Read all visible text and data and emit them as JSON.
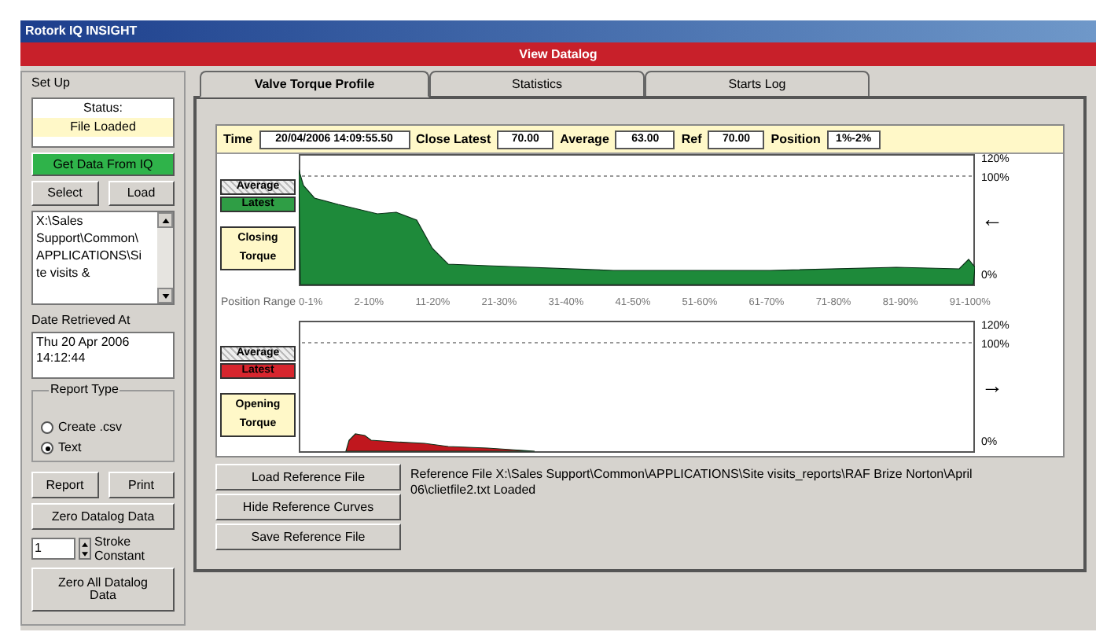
{
  "window": {
    "title": "Rotork IQ INSIGHT"
  },
  "header": {
    "title": "View Datalog"
  },
  "setup": {
    "label": "Set Up",
    "status_label": "Status:",
    "status_value": "File Loaded",
    "get_data_button": "Get Data From IQ",
    "select_button": "Select",
    "load_button": "Load",
    "file_list": [
      "X:\\Sales",
      "Support\\Common\\",
      "APPLICATIONS\\Si",
      "te visits &"
    ],
    "date_label": "Date Retrieved At",
    "date_value": [
      "Thu 20 Apr 2006",
      "14:12:44"
    ],
    "report_type": {
      "label": "Report Type",
      "options": [
        {
          "label": "Create .csv",
          "selected": false
        },
        {
          "label": "Text",
          "selected": true
        }
      ]
    },
    "report_button": "Report",
    "print_button": "Print",
    "zero_button": "Zero Datalog Data",
    "stroke_value": "1",
    "stroke_label": "Stroke Constant",
    "zero_all_button": "Zero All Datalog Data"
  },
  "tabs": [
    {
      "label": "Valve Torque Profile",
      "selected": true
    },
    {
      "label": "Statistics",
      "selected": false
    },
    {
      "label": "Starts Log",
      "selected": false
    }
  ],
  "info_bar": [
    {
      "label": "Time",
      "value": "20/04/2006 14:09:55.50"
    },
    {
      "label": "Close Latest",
      "value": "70.00"
    },
    {
      "label": "Average",
      "value": "63.00"
    },
    {
      "label": "Ref",
      "value": "70.00"
    },
    {
      "label": "Position",
      "value": "1%-2%"
    }
  ],
  "charts": [
    {
      "kind": "closing",
      "legend_average": "Average",
      "legend_latest": "Latest",
      "title": "Closing Torque",
      "arrow": "←",
      "yticks": [
        "120%",
        "100%",
        "0%"
      ]
    },
    {
      "kind": "opening",
      "legend_average": "Average",
      "legend_latest": "Latest",
      "title": "Opening Torque",
      "arrow": "→",
      "yticks": [
        "120%",
        "100%",
        "0%"
      ]
    }
  ],
  "position_range": {
    "label": "Position Range",
    "ranges": [
      "0-1%",
      "2-10%",
      "11-20%",
      "21-30%",
      "31-40%",
      "41-50%",
      "51-60%",
      "61-70%",
      "71-80%",
      "81-90%",
      "91-100%"
    ]
  },
  "reference_buttons": [
    "Load Reference File",
    "Hide Reference Curves",
    "Save Reference File"
  ],
  "reference_message": "Reference File X:\\Sales Support\\Common\\APPLICATIONS\\Site visits_reports\\RAF Brize Norton\\April 06\\clietfile2.txt Loaded"
}
